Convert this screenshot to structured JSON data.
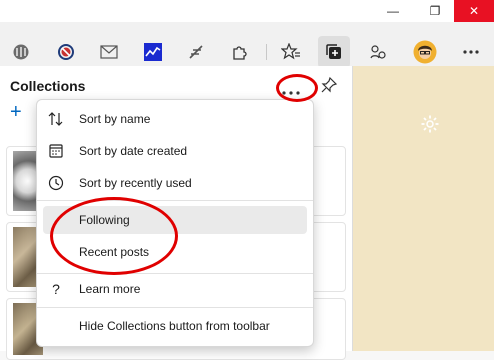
{
  "window": {
    "minimize_glyph": "—",
    "restore_glyph": "❐",
    "close_glyph": "✕"
  },
  "panel": {
    "title": "Collections",
    "add_glyph": "+"
  },
  "menu": {
    "items": [
      {
        "label": "Sort by name",
        "icon": "sort-icon"
      },
      {
        "label": "Sort by date created",
        "icon": "calendar-icon"
      },
      {
        "label": "Sort by recently used",
        "icon": "clock-icon"
      },
      {
        "label": "Following",
        "icon": ""
      },
      {
        "label": "Recent posts",
        "icon": ""
      },
      {
        "label": "Learn more",
        "icon": "help-icon",
        "glyph": "?"
      },
      {
        "label": "Hide Collections button from toolbar",
        "icon": ""
      }
    ]
  },
  "colors": {
    "annotation": "#e00000",
    "close_button": "#e81123",
    "side_area": "#f2e5c4",
    "accent_blue": "#0067c0"
  }
}
